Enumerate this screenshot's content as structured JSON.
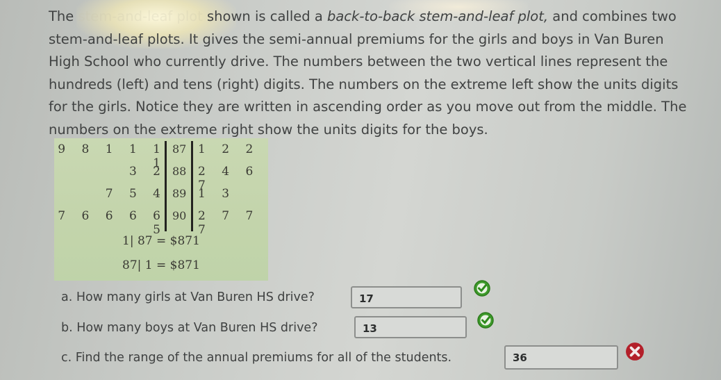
{
  "intro": {
    "line1_a": "The ",
    "line1_obscured": "stem-and-leaf plot",
    "line1_b": " shown is called a ",
    "line1_italic": "back-to-back stem-and-leaf plot,",
    "line1_c": " and combines two",
    "line2": "stem-and-leaf plots. It gives the semi-annual premiums for the girls and boys in Van Buren",
    "line3": "High School who currently drive. The numbers between the two vertical lines represent the",
    "line4": "hundreds (left) and tens (right) digits. The numbers on the extreme left show the units digits",
    "line5": "for the girls. Notice they are written in ascending order as you move out from the middle. The",
    "line6": "numbers on the extreme right show the units digits for the boys."
  },
  "plot": {
    "rows": [
      {
        "left": "9 8 1 1 1 1",
        "stem": "87",
        "right": "1 2 2"
      },
      {
        "left": "3 2",
        "stem": "88",
        "right": "2 4 6 7"
      },
      {
        "left": "7 5 4",
        "stem": "89",
        "right": "1 3"
      },
      {
        "left": "7 6 6 6 6 5",
        "stem": "90",
        "right": "2 7 7 7"
      }
    ],
    "key_girls": "1| 87 = $871",
    "key_boys": "87| 1 = $871"
  },
  "questions": [
    {
      "label": "a. How many girls at Van Buren HS drive?",
      "answer": "17",
      "status": "correct"
    },
    {
      "label": "b. How many boys at Van Buren HS drive?",
      "answer": "13",
      "status": "correct"
    },
    {
      "label": "c. Find the range of the annual premiums for all of the students.",
      "answer": "36",
      "status": "incorrect"
    }
  ],
  "colors": {
    "correct": "#3d9a2a",
    "incorrect": "#b3202a"
  }
}
